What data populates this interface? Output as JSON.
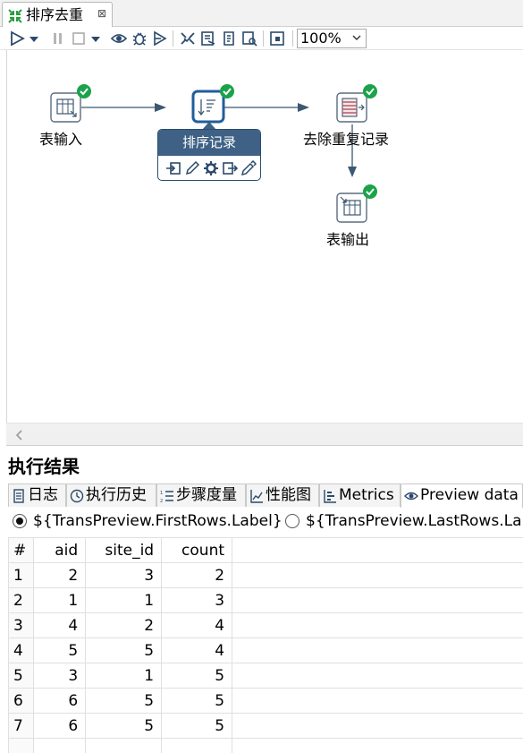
{
  "editor_tab": {
    "title": "排序去重",
    "close_glyph": "⊠"
  },
  "toolbar": {
    "zoom_value": "100%",
    "buttons": [
      "run-icon",
      "run-dropdown-icon",
      "pause-icon",
      "stop-icon",
      "stop-dropdown-icon",
      "preview-icon",
      "debug-icon",
      "replay-icon",
      "verify-icon",
      "impact-icon",
      "sql-icon",
      "explore-db-icon",
      "show-results-icon"
    ]
  },
  "canvas": {
    "steps": [
      {
        "name": "表输入",
        "status": "success"
      },
      {
        "name": "排序记录",
        "status": "success"
      },
      {
        "name": "去除重复记录",
        "status": "success"
      },
      {
        "name": "表输出",
        "status": "success"
      }
    ],
    "popup": {
      "title": "排序记录",
      "tools": [
        "input-fields-icon",
        "edit-icon",
        "settings-icon",
        "output-fields-icon",
        "pencil-icon"
      ]
    },
    "scroll_left_glyph": "<"
  },
  "results": {
    "title": "执行结果",
    "tabs": [
      {
        "label": "日志",
        "icon": "log-icon"
      },
      {
        "label": "执行历史",
        "icon": "history-icon"
      },
      {
        "label": "步骤度量",
        "icon": "step-metrics-icon"
      },
      {
        "label": "性能图",
        "icon": "performance-chart-icon"
      },
      {
        "label": "Metrics",
        "icon": "metrics-icon"
      },
      {
        "label": "Preview data",
        "icon": "eye-icon"
      }
    ],
    "active_tab": "Preview data",
    "radio_first": "${TransPreview.FirstRows.Label}",
    "radio_last": "${TransPreview.LastRows.Label}",
    "grid": {
      "index_header": "#",
      "columns": [
        "aid",
        "site_id",
        "count"
      ],
      "rows": [
        {
          "idx": "1",
          "aid": "2",
          "site_id": "3",
          "count": "2"
        },
        {
          "idx": "2",
          "aid": "1",
          "site_id": "1",
          "count": "3"
        },
        {
          "idx": "3",
          "aid": "4",
          "site_id": "2",
          "count": "4"
        },
        {
          "idx": "4",
          "aid": "5",
          "site_id": "5",
          "count": "4"
        },
        {
          "idx": "5",
          "aid": "3",
          "site_id": "1",
          "count": "5"
        },
        {
          "idx": "6",
          "aid": "6",
          "site_id": "5",
          "count": "5"
        },
        {
          "idx": "7",
          "aid": "6",
          "site_id": "5",
          "count": "5"
        }
      ]
    }
  },
  "colors": {
    "success": "#1aa34a",
    "popup_header": "#3e6185",
    "step_border": "#5a6d80",
    "selected_border": "#1f5e9c",
    "hop": "#3c5872"
  }
}
